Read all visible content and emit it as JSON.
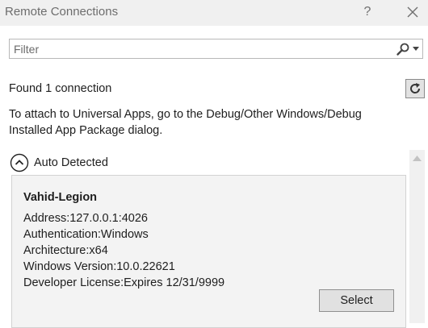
{
  "window": {
    "title": "Remote Connections",
    "help_label": "?"
  },
  "filter": {
    "placeholder": "Filter",
    "value": ""
  },
  "status": {
    "found_text": "Found 1 connection"
  },
  "info": {
    "attach_text": "To attach to Universal Apps, go to the Debug/Other Windows/Debug Installed App Package dialog."
  },
  "group": {
    "label": "Auto Detected",
    "expanded": true
  },
  "connection": {
    "name": "Vahid-Legion",
    "address": "Address:127.0.0.1:4026",
    "authentication": "Authentication:Windows",
    "architecture": "Architecture:x64",
    "windows_version": "Windows Version:10.0.22621",
    "developer_license": "Developer License:Expires 12/31/9999",
    "select_label": "Select"
  },
  "icons": {
    "close": "close-icon",
    "search": "search-icon",
    "dropdown": "chevron-down-icon",
    "refresh": "refresh-icon",
    "collapse": "chevron-up-circle-icon",
    "scroll_up": "scroll-up-arrow-icon"
  },
  "colors": {
    "titlebar_bg": "#f0f0f0",
    "card_bg": "#f3f3f3",
    "button_bg": "#e1e1e1",
    "text": "#1e1e1e"
  }
}
